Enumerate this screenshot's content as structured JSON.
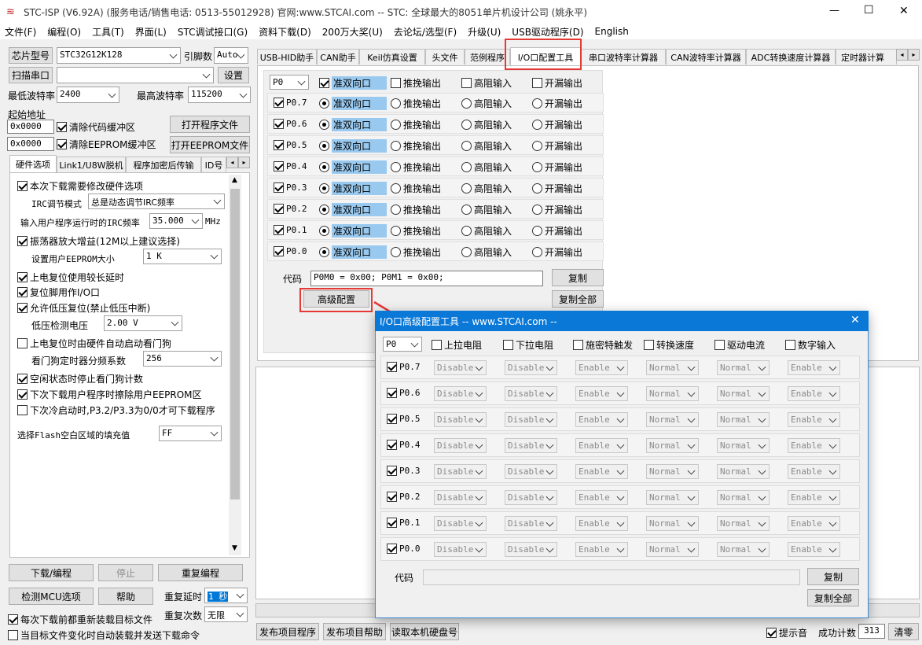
{
  "window": {
    "title": "STC-ISP (V6.92A) (服务电话/销售电话: 0513-55012928) 官网:www.STCAI.com  -- STC: 全球最大的8051单片机设计公司 (姚永平)",
    "min": "—",
    "max": "☐",
    "close": "✕"
  },
  "menu": [
    "文件(F)",
    "编程(O)",
    "工具(T)",
    "界面(L)",
    "STC调试接口(G)",
    "资料下载(D)",
    "200万大奖(U)",
    "去论坛/选型(F)",
    "升级(U)",
    "USB驱动程序(D)",
    "English"
  ],
  "left": {
    "chip_label": "芯片型号",
    "chip_value": "STC32G12K128",
    "pins_label": "引脚数",
    "pins_value": "Auto",
    "scan_button": "扫描串口",
    "port_value": "",
    "settings_button": "设置",
    "min_baud_label": "最低波特率",
    "min_baud_value": "2400",
    "max_baud_label": "最高波特率",
    "max_baud_value": "115200",
    "start_addr_label": "起始地址",
    "addr1": "0x0000",
    "clear_code": "清除代码缓冲区",
    "open_prog": "打开程序文件",
    "addr2": "0x0000",
    "clear_eeprom": "清除EEPROM缓冲区",
    "open_eeprom": "打开EEPROM文件",
    "tabs": [
      "硬件选项",
      "Link1/U8W脱机",
      "程序加密后传输",
      "ID号"
    ],
    "options": {
      "modify_hw": "本次下载需要修改硬件选项",
      "irc_mode_label": "IRC调节模式",
      "irc_mode_value": "总是动态调节IRC频率",
      "irc_freq_label": "输入用户程序运行时的IRC频率",
      "irc_freq_value": "35.000",
      "irc_unit": "MHz",
      "osc_gain": "振荡器放大增益(12M以上建议选择)",
      "eeprom_label": "设置用户EEPROM大小",
      "eeprom_value": "1    K",
      "long_reset": "上电复位使用较长延时",
      "reset_pin_io": "复位脚用作I/O口",
      "lvd_reset": "允许低压复位(禁止低压中断)",
      "lvd_label": "低压检测电压",
      "lvd_value": "2.00 V",
      "wdt_start": "上电复位时由硬件自动启动看门狗",
      "wdt_div_label": "看门狗定时器分频系数",
      "wdt_div_value": "256",
      "idle_wdt": "空闲状态时停止看门狗计数",
      "erase_eeprom": "下次下载用户程序时擦除用户EEPROM区",
      "p32p33": "下次冷启动时,P3.2/P3.3为0/0才可下载程序",
      "flash_fill_label": "选择Flash空白区域的填充值",
      "flash_fill_value": "FF"
    },
    "download_button": "下载/编程",
    "stop_button": "停止",
    "reprogram_button": "重复编程",
    "detect_button": "检测MCU选项",
    "help_button": "帮助",
    "repeat_delay_label": "重复延时",
    "repeat_delay_value": "1 秒",
    "repeat_count_label": "重复次数",
    "repeat_count_value": "无限",
    "reload_label": "每次下载前都重新装载目标文件",
    "auto_load_label": "当目标文件变化时自动装载并发送下载命令"
  },
  "right": {
    "tabs": [
      "USB-HID助手",
      "CAN助手",
      "Keil仿真设置",
      "头文件",
      "范例程序",
      "I/O口配置工具",
      "串口波特率计算器",
      "CAN波特率计算器",
      "ADC转换速度计算器",
      "定时器计算"
    ],
    "io": {
      "port": "P0",
      "modes": [
        "准双向口",
        "推挽输出",
        "高阻输入",
        "开漏输出"
      ],
      "pins": [
        "P0.7",
        "P0.6",
        "P0.5",
        "P0.4",
        "P0.3",
        "P0.2",
        "P0.1",
        "P0.0"
      ],
      "code_label": "代码",
      "code_value": "P0M0 = 0x00; P0M1 = 0x00;",
      "copy": "复制",
      "copy_all": "复制全部",
      "advanced": "高级配置"
    },
    "bottom": {
      "publish_prog": "发布项目程序",
      "publish_help": "发布项目帮助",
      "read_disk": "读取本机硬盘号",
      "sound_label": "提示音",
      "success_label": "成功计数",
      "success_value": "313",
      "clear": "清零"
    }
  },
  "dialog": {
    "title": "I/O口高级配置工具 -- www.STCAI.com --",
    "close": "✕",
    "port": "P0",
    "headers": [
      "上拉电阻",
      "下拉电阻",
      "施密特触发",
      "转换速度",
      "驱动电流",
      "数字输入"
    ],
    "pins": [
      "P0.7",
      "P0.6",
      "P0.5",
      "P0.4",
      "P0.3",
      "P0.2",
      "P0.1",
      "P0.0"
    ],
    "values": [
      "Disable",
      "Disable",
      "Enable",
      "Normal",
      "Normal",
      "Enable"
    ],
    "code_label": "代码",
    "code_value": "",
    "copy": "复制",
    "copy_all": "复制全部"
  },
  "annotation_color": "#e53935"
}
